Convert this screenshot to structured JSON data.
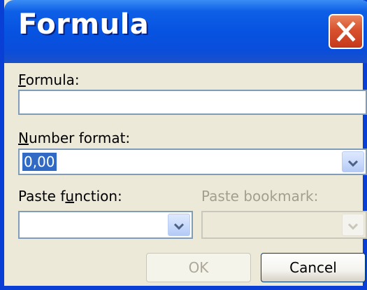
{
  "dialog": {
    "title": "Formula",
    "close_icon": "close-icon"
  },
  "formula": {
    "label_access_key": "F",
    "label_rest": "ormula:",
    "value": ""
  },
  "number_format": {
    "label_access_key": "N",
    "label_rest": "umber format:",
    "selected_value": "0,00"
  },
  "paste_function": {
    "label_before": "Paste f",
    "label_access_key": "u",
    "label_after": "nction:",
    "selected_value": ""
  },
  "paste_bookmark": {
    "label": "Paste bookmark:",
    "selected_value": ""
  },
  "buttons": {
    "ok_label": "OK",
    "cancel_label": "Cancel"
  },
  "colors": {
    "title_bar": "#0753e1",
    "close_button": "#d8512e",
    "selection": "#316ac5",
    "dialog_bg": "#ece9d8"
  }
}
